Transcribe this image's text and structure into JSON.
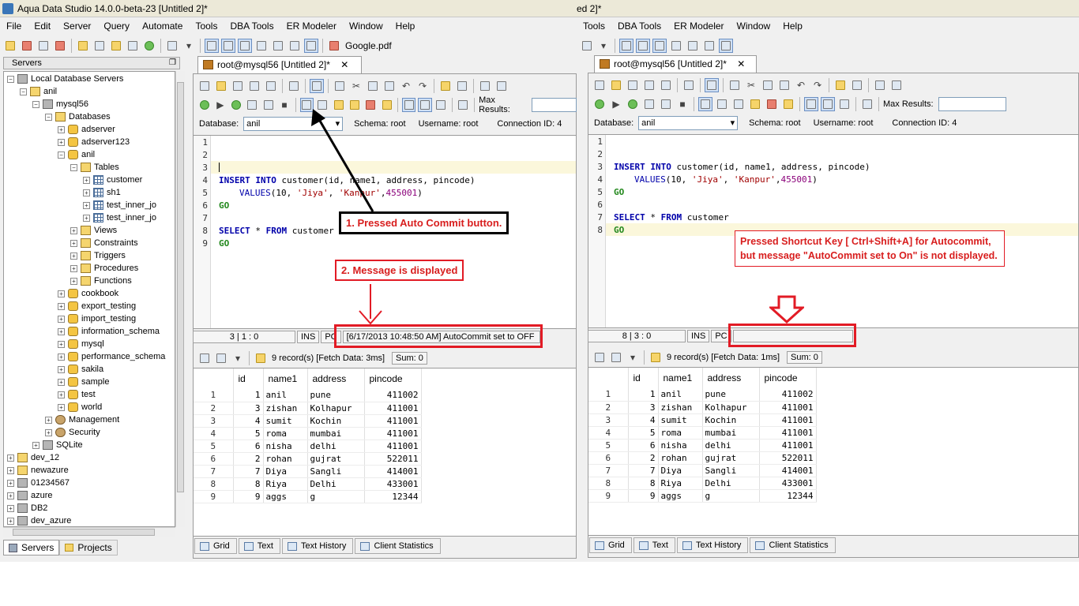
{
  "left": {
    "window_title": "Aqua Data Studio 14.0.0-beta-23 [Untitled 2]*",
    "menu": [
      "File",
      "Edit",
      "Server",
      "Query",
      "Automate",
      "Tools",
      "DBA Tools",
      "ER Modeler",
      "Window",
      "Help"
    ],
    "toolbar_file": "Google.pdf",
    "servers_panel_title": "Servers",
    "tree": [
      {
        "label": "Local Database Servers",
        "depth": 0,
        "icon": "server-icon",
        "exp": "-"
      },
      {
        "label": "anil",
        "depth": 1,
        "icon": "folder-icon",
        "exp": "-"
      },
      {
        "label": "mysql56",
        "depth": 2,
        "icon": "server-icon",
        "exp": "-"
      },
      {
        "label": "Databases",
        "depth": 3,
        "icon": "folder-icon",
        "exp": "-"
      },
      {
        "label": "adserver",
        "depth": 4,
        "icon": "database-icon",
        "exp": "+"
      },
      {
        "label": "adserver123",
        "depth": 4,
        "icon": "database-icon",
        "exp": "+"
      },
      {
        "label": "anil",
        "depth": 4,
        "icon": "database-icon",
        "exp": "-"
      },
      {
        "label": "Tables",
        "depth": 5,
        "icon": "folder-icon",
        "exp": "-"
      },
      {
        "label": "customer",
        "depth": 6,
        "icon": "table-icon",
        "exp": "+"
      },
      {
        "label": "sh1",
        "depth": 6,
        "icon": "table-icon",
        "exp": "+"
      },
      {
        "label": "test_inner_jo",
        "depth": 6,
        "icon": "table-icon",
        "exp": "+"
      },
      {
        "label": "test_inner_jo",
        "depth": 6,
        "icon": "table-icon",
        "exp": "+"
      },
      {
        "label": "Views",
        "depth": 5,
        "icon": "folder-icon",
        "exp": "+"
      },
      {
        "label": "Constraints",
        "depth": 5,
        "icon": "folder-icon",
        "exp": "+"
      },
      {
        "label": "Triggers",
        "depth": 5,
        "icon": "folder-icon",
        "exp": "+"
      },
      {
        "label": "Procedures",
        "depth": 5,
        "icon": "folder-icon",
        "exp": "+"
      },
      {
        "label": "Functions",
        "depth": 5,
        "icon": "folder-icon",
        "exp": "+"
      },
      {
        "label": "cookbook",
        "depth": 4,
        "icon": "database-icon",
        "exp": "+"
      },
      {
        "label": "export_testing",
        "depth": 4,
        "icon": "database-icon",
        "exp": "+"
      },
      {
        "label": "import_testing",
        "depth": 4,
        "icon": "database-icon",
        "exp": "+"
      },
      {
        "label": "information_schema",
        "depth": 4,
        "icon": "database-icon",
        "exp": "+"
      },
      {
        "label": "mysql",
        "depth": 4,
        "icon": "database-icon",
        "exp": "+"
      },
      {
        "label": "performance_schema",
        "depth": 4,
        "icon": "database-icon",
        "exp": "+"
      },
      {
        "label": "sakila",
        "depth": 4,
        "icon": "database-icon",
        "exp": "+"
      },
      {
        "label": "sample",
        "depth": 4,
        "icon": "database-icon",
        "exp": "+"
      },
      {
        "label": "test",
        "depth": 4,
        "icon": "database-icon",
        "exp": "+"
      },
      {
        "label": "world",
        "depth": 4,
        "icon": "database-icon",
        "exp": "+"
      },
      {
        "label": "Management",
        "depth": 3,
        "icon": "management-icon",
        "exp": "+"
      },
      {
        "label": "Security",
        "depth": 3,
        "icon": "security-icon",
        "exp": "+"
      },
      {
        "label": "SQLite",
        "depth": 2,
        "icon": "server-icon",
        "exp": "+"
      },
      {
        "label": "dev_12",
        "depth": 0,
        "icon": "folder-icon",
        "exp": "+"
      },
      {
        "label": "newazure",
        "depth": 0,
        "icon": "folder-icon",
        "exp": "+"
      },
      {
        "label": "01234567",
        "depth": 0,
        "icon": "server-icon",
        "exp": "+"
      },
      {
        "label": "azure",
        "depth": 0,
        "icon": "server-icon",
        "exp": "+"
      },
      {
        "label": "DB2",
        "depth": 0,
        "icon": "server-icon",
        "exp": "+"
      },
      {
        "label": "dev_azure",
        "depth": 0,
        "icon": "server-icon",
        "exp": "+"
      }
    ],
    "bottom_tabs": [
      "Servers",
      "Projects"
    ],
    "tab_title": "root@mysql56 [Untitled 2]*",
    "max_results_label": "Max Results:",
    "database_label": "Database:",
    "database_value": "anil",
    "schema": "Schema:  root",
    "username": "Username:  root",
    "connection": "Connection ID:  4",
    "line_numbers": [
      "1",
      "2",
      "3",
      "4",
      "5",
      "6",
      "7",
      "8",
      "9"
    ],
    "status_pos": "3 | 1 : 0",
    "status_ins": "INS",
    "status_pc": "PC",
    "status_message": "[6/17/2013 10:48:50 AM] AutoCommit set to OFF",
    "records": "9 record(s) [Fetch Data: 3ms]",
    "sum": "Sum: 0",
    "annotation_1": "1. Pressed Auto Commit button.",
    "annotation_2": "2. Message is displayed"
  },
  "right": {
    "window_title_fragment": "ed 2]*",
    "menu": [
      "Tools",
      "DBA Tools",
      "ER Modeler",
      "Window",
      "Help"
    ],
    "tab_title": "root@mysql56 [Untitled 2]*",
    "max_results_label": "Max Results:",
    "database_label": "Database:",
    "database_value": "anil",
    "schema": "Schema:  root",
    "username": "Username:  root",
    "connection": "Connection ID:  4",
    "line_numbers": [
      "1",
      "2",
      "3",
      "4",
      "5",
      "6",
      "7",
      "8"
    ],
    "status_pos": "8 | 3 : 0",
    "status_ins": "INS",
    "status_pc": "PC",
    "status_message": "",
    "records": "9 record(s) [Fetch Data: 1ms]",
    "sum": "Sum: 0",
    "annotation": "Pressed Shortcut Key [ Ctrl+Shift+A] for Autocommit, but message \"AutoCommit set to On\" is not displayed."
  },
  "sql": {
    "insert_kw": "INSERT INTO",
    "insert_rest": " customer(id, name1, address, pincode)",
    "values_kw": "VALUES",
    "values_open": "(10, ",
    "values_s1": "'Jiya'",
    "values_comma": ", ",
    "values_s2": "'Kanpur'",
    "values_comma2": ",",
    "values_num": "455001",
    "values_close": ")",
    "go": "GO",
    "select_kw1": "SELECT",
    "select_star": " * ",
    "select_kw2": "FROM",
    "select_rest": " customer"
  },
  "grid": {
    "columns": [
      "id",
      "name1",
      "address",
      "pincode"
    ],
    "rows": [
      [
        "1",
        "1",
        "anil",
        "pune",
        "411002"
      ],
      [
        "2",
        "3",
        "zishan",
        "Kolhapur",
        "411001"
      ],
      [
        "3",
        "4",
        "sumit",
        "Kochin",
        "411001"
      ],
      [
        "4",
        "5",
        "roma",
        "mumbai",
        "411001"
      ],
      [
        "5",
        "6",
        "nisha",
        "delhi",
        "411001"
      ],
      [
        "6",
        "2",
        "rohan",
        "gujrat",
        "522011"
      ],
      [
        "7",
        "7",
        "Diya",
        "Sangli",
        "414001"
      ],
      [
        "8",
        "8",
        "Riya",
        "Delhi",
        "433001"
      ],
      [
        "9",
        "9",
        "aggs",
        "g",
        "12344"
      ]
    ]
  },
  "result_tabs": [
    "Grid",
    "Text",
    "Text History",
    "Client Statistics"
  ],
  "colors": {
    "annotation_red": "#e21b25",
    "selected_toolbar": "#cfe0f5"
  }
}
